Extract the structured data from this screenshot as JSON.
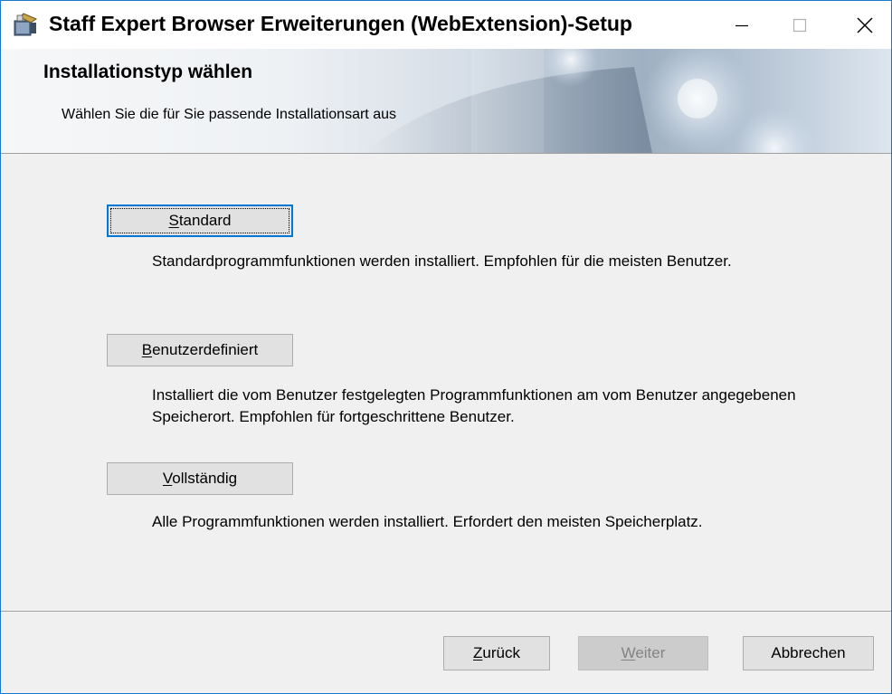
{
  "window": {
    "title": "Staff Expert Browser Erweiterungen (WebExtension)-Setup",
    "app_icon": "installer-package-icon",
    "controls": {
      "minimize": "minimize-icon",
      "maximize": "maximize-icon",
      "close": "close-icon"
    }
  },
  "banner": {
    "heading": "Installationstyp wählen",
    "subheading": "Wählen Sie die für Sie passende Installationsart aus"
  },
  "options": [
    {
      "key": "S",
      "rest": "tandard",
      "prefix": "",
      "description": "Standardprogrammfunktionen werden installiert. Empfohlen für die meisten Benutzer.",
      "focused": true
    },
    {
      "key": "B",
      "rest": "enutzerdefiniert",
      "prefix": "",
      "description": "Installiert die vom Benutzer festgelegten Programmfunktionen am vom Benutzer angegebenen Speicherort. Empfohlen für fortgeschrittene Benutzer.",
      "focused": false
    },
    {
      "key": "V",
      "rest": "ollständig",
      "prefix": "",
      "description": "Alle Programmfunktionen werden installiert. Erfordert den meisten Speicherplatz.",
      "focused": false
    }
  ],
  "footer": {
    "back": {
      "key": "Z",
      "rest": "urück"
    },
    "next": {
      "key": "W",
      "rest": "eiter",
      "enabled": false
    },
    "cancel": {
      "label": "Abbrechen"
    }
  },
  "colors": {
    "accent": "#0078d7",
    "button_face": "#e1e1e1",
    "disabled_text": "#838383",
    "window_border": "#1a79c9"
  }
}
